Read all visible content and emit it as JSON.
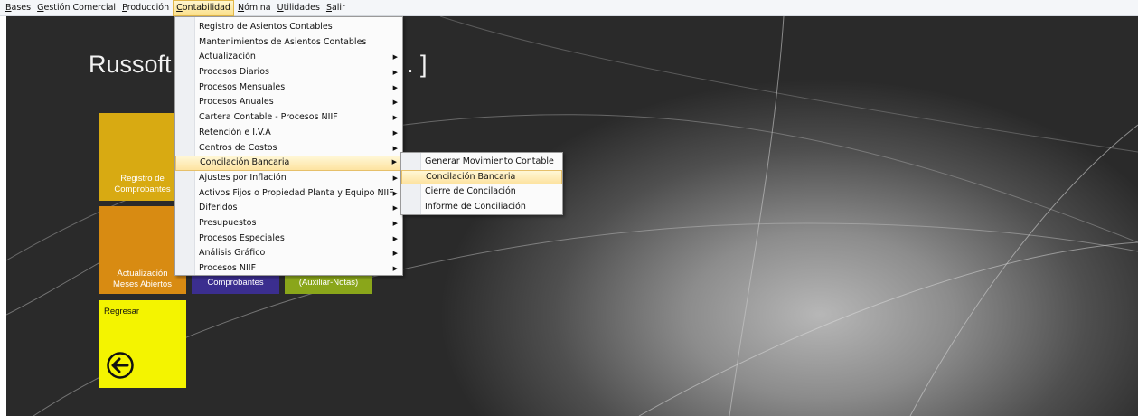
{
  "menubar": [
    {
      "label": "Bases",
      "u": "B",
      "rest": "ases"
    },
    {
      "label": "Gestión Comercial",
      "u": "G",
      "rest": "estión Comercial"
    },
    {
      "label": "Producción",
      "u": "P",
      "rest": "roducción"
    },
    {
      "label": "Contabilidad",
      "u": "C",
      "rest": "ontabilidad",
      "active": true
    },
    {
      "label": "Nómina",
      "u": "N",
      "rest": "ómina"
    },
    {
      "label": "Utilidades",
      "u": "U",
      "rest": "tilidades"
    },
    {
      "label": "Salir",
      "u": "S",
      "rest": "alir"
    }
  ],
  "app_title": "Russoft",
  "app_title_suffix": ". ]",
  "tiles": {
    "registro": "Registro de\nComprobantes",
    "actualizacion": "Actualización\nMeses Abiertos",
    "comprobantes": "Comprobantes",
    "auxiliar": "(Auxiliar-Notas)",
    "regresar": "Regresar",
    "regresar_icon": "back-arrow-icon"
  },
  "contabilidad_menu": [
    {
      "label": "Registro de Asientos Contables",
      "submenu": false
    },
    {
      "label": "Mantenimientos de Asientos Contables",
      "submenu": false
    },
    {
      "label": "Actualización",
      "submenu": true
    },
    {
      "label": "Procesos Diarios",
      "submenu": true
    },
    {
      "label": "Procesos Mensuales",
      "submenu": true
    },
    {
      "label": "Procesos Anuales",
      "submenu": true
    },
    {
      "label": "Cartera Contable - Procesos NIIF",
      "submenu": true
    },
    {
      "label": "Retención e I.V.A",
      "submenu": true
    },
    {
      "label": "Centros de Costos",
      "submenu": true
    },
    {
      "label": "Concilación Bancaria",
      "submenu": true,
      "highlighted": true
    },
    {
      "label": "Ajustes por Inflación",
      "submenu": true
    },
    {
      "label": "Activos Fijos o Propiedad Planta y Equipo NIIF",
      "submenu": true
    },
    {
      "label": "Diferidos",
      "submenu": true
    },
    {
      "label": "Presupuestos",
      "submenu": true
    },
    {
      "label": "Procesos Especiales",
      "submenu": true
    },
    {
      "label": "Análisis Gráfico",
      "submenu": true
    },
    {
      "label": "Procesos NIIF",
      "submenu": true
    }
  ],
  "conciliacion_submenu": [
    {
      "label": "Generar Movimiento Contable"
    },
    {
      "label": "Concilación Bancaria",
      "highlighted": true
    },
    {
      "label": "Cierre de Concilación"
    },
    {
      "label": "Informe de Conciliación"
    }
  ],
  "colors": {
    "tile_registro": "#d8aa12",
    "tile_actualizacion": "#d88b12",
    "tile_comprobantes": "#3b2e8f",
    "tile_auxiliar": "#8aa61a",
    "tile_regresar": "#f4f400",
    "menu_highlight": "#fde3a0"
  }
}
